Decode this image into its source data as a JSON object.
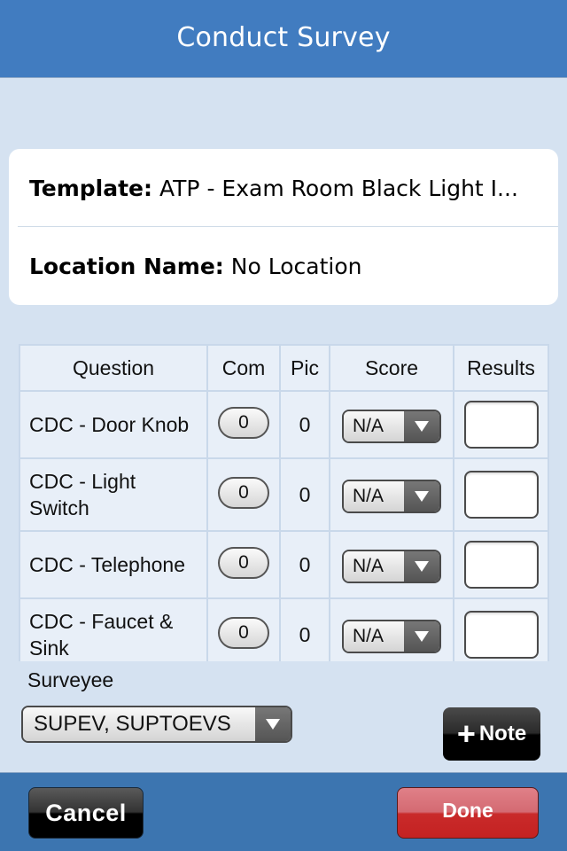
{
  "navbar": {
    "title": "Conduct Survey"
  },
  "info": {
    "template_label": "Template:",
    "template_value": "ATP - Exam Room Black Light I...",
    "location_label": "Location Name:",
    "location_value": "No Location"
  },
  "table": {
    "headers": {
      "question": "Question",
      "com": "Com",
      "pic": "Pic",
      "score": "Score",
      "results": "Results"
    },
    "rows": [
      {
        "question": "CDC - Door Knob",
        "com": "0",
        "pic": "0",
        "score": "N/A",
        "result": ""
      },
      {
        "question": "CDC - Light Switch",
        "com": "0",
        "pic": "0",
        "score": "N/A",
        "result": ""
      },
      {
        "question": "CDC - Telephone",
        "com": "0",
        "pic": "0",
        "score": "N/A",
        "result": ""
      },
      {
        "question": "CDC - Faucet & Sink",
        "com": "0",
        "pic": "0",
        "score": "N/A",
        "result": ""
      }
    ]
  },
  "surveyee": {
    "label": "Surveyee",
    "value": "SUPEV, SUPTOEVS"
  },
  "note_button": {
    "icon": "plus-icon",
    "label": "Note"
  },
  "toolbar": {
    "cancel_label": "Cancel",
    "done_label": "Done"
  },
  "colors": {
    "navbar": "#417cc0",
    "toolbar": "#3c75b0",
    "background": "#d5e2f1",
    "done": "#c92a2a"
  }
}
